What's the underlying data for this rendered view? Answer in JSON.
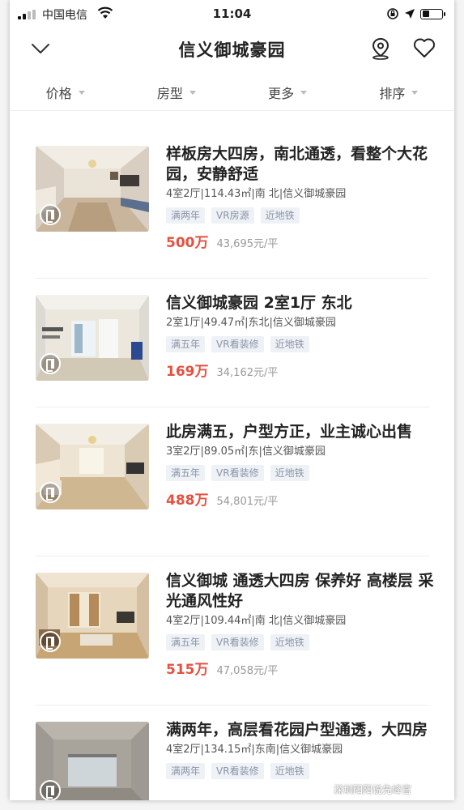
{
  "status": {
    "carrier": "中国电信",
    "time": "11:04"
  },
  "nav": {
    "title": "信义御城豪园"
  },
  "filters": [
    "价格",
    "房型",
    "更多",
    "排序"
  ],
  "listings": [
    {
      "title": "样板房大四房，南北通透，看整个大花园，安静舒适",
      "meta": "4室2厅|114.43㎡|南 北|信义御城豪园",
      "tags": [
        "满两年",
        "VR房源",
        "近地铁"
      ],
      "price": "500万",
      "unit_price": "43,695元/平"
    },
    {
      "title": "信义御城豪园 2室1厅 东北",
      "meta": "2室1厅|49.47㎡|东北|信义御城豪园",
      "tags": [
        "满五年",
        "VR看装修",
        "近地铁"
      ],
      "price": "169万",
      "unit_price": "34,162元/平"
    },
    {
      "title": "此房满五，户型方正，业主诚心出售",
      "meta": "3室2厅|89.05㎡|东|信义御城豪园",
      "tags": [
        "满五年",
        "VR看装修",
        "近地铁"
      ],
      "price": "488万",
      "unit_price": "54,801元/平"
    },
    {
      "title": "信义御城 通透大四房 保养好 高楼层 采光通风性好",
      "meta": "4室2厅|109.44㎡|南 北|信义御城豪园",
      "tags": [
        "满五年",
        "VR看装修",
        "近地铁"
      ],
      "price": "515万",
      "unit_price": "47,058元/平"
    },
    {
      "title": "满两年，高层看花园户型通透，大四房",
      "meta": "4室2厅|134.15㎡|东南|信义御城豪园",
      "tags": [
        "满两年",
        "VR看装修",
        "近地铁"
      ],
      "price": "",
      "unit_price": ""
    }
  ],
  "watermark": "深圳阳阳说先峰官",
  "icons": [
    "signal-icon",
    "wifi-icon",
    "lock-rotation-icon",
    "location-arrow-icon",
    "battery-icon",
    "chevron-down-icon",
    "map-pin-icon",
    "heart-icon",
    "vr-icon"
  ],
  "colors": {
    "price": "#e8503f",
    "tag_bg": "#eef1f6",
    "tag_text": "#8b95a5"
  }
}
